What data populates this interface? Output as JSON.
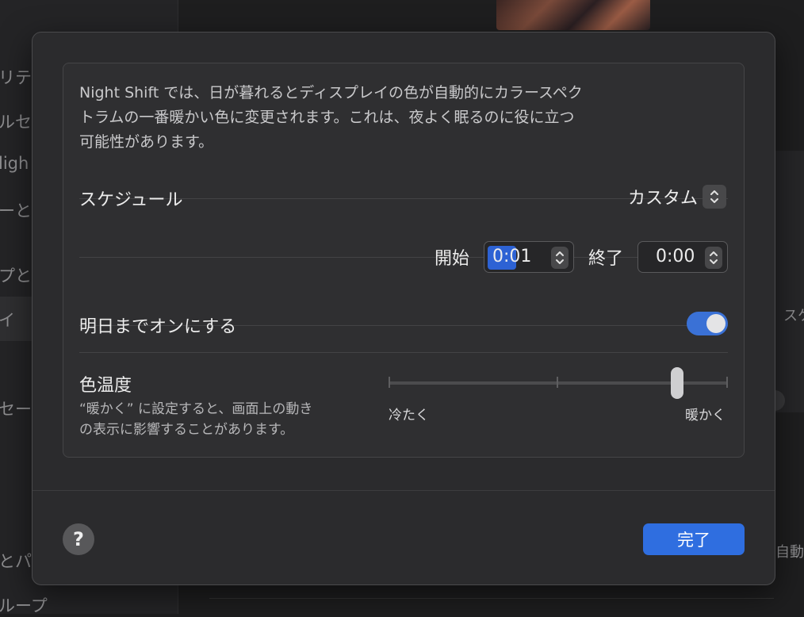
{
  "background": {
    "sidebar_fragments": [
      "リテ",
      "ルセ",
      "ligh",
      "ーと",
      "プと",
      "イ",
      "セー",
      "とパ",
      "ループ"
    ],
    "right_fragments": [
      "スケ",
      "自動"
    ]
  },
  "dialog": {
    "description_lines": [
      "Night Shift では、日が暮れるとディスプレイの色が自動的にカラースペク",
      "トラムの一番暖かい色に変更されます。これは、夜よく眠るのに役に立つ",
      "可能性があります。"
    ],
    "schedule": {
      "label": "スケジュール",
      "value": "カスタム"
    },
    "time": {
      "start_label": "開始",
      "start_value": "0:01",
      "end_label": "終了",
      "end_value": "0:00"
    },
    "until_tomorrow": {
      "label": "明日までオンにする",
      "on": true
    },
    "color_temperature": {
      "label": "色温度",
      "sub_lines": [
        "“暖かく” に設定すると、画面上の動き",
        "の表示に影響することがあります。"
      ],
      "min_label": "冷たく",
      "max_label": "暖かく",
      "level": 0.85
    },
    "help_label": "?",
    "done_label": "完了"
  },
  "colors": {
    "accent": "#2f6ee0",
    "toggle_on": "#3a71d6",
    "dialog_bg": "#2b2b2d"
  },
  "icons": {
    "stepper": "up-down-chevron-icon",
    "help": "question-mark-icon"
  }
}
